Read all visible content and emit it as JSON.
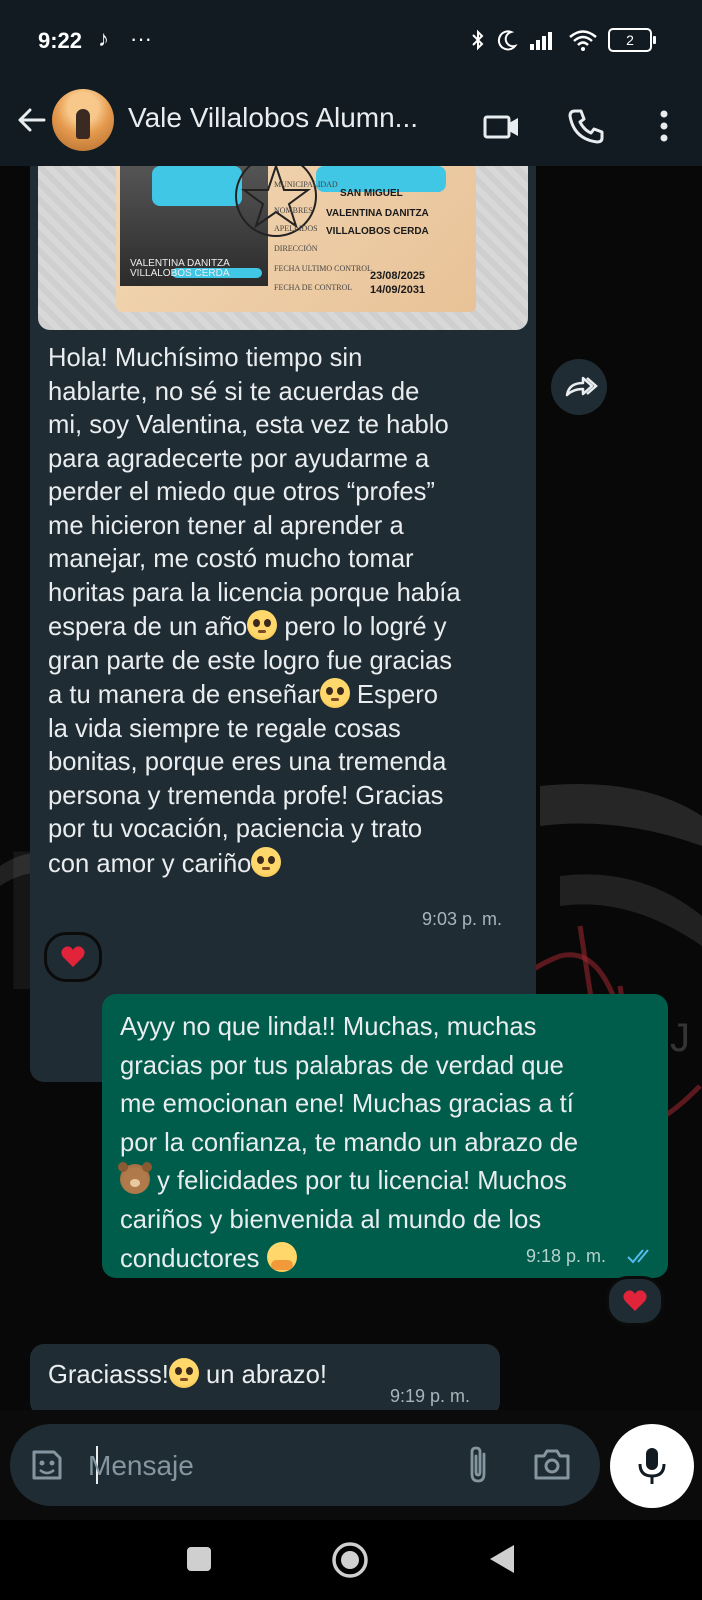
{
  "status_bar": {
    "time": "9:22",
    "battery": "2",
    "icons": [
      "tiktok-icon",
      "more-icon",
      "bluetooth-icon",
      "moon-icon",
      "signal-icon",
      "wifi-icon",
      "battery-icon"
    ]
  },
  "header": {
    "contact_name": "Vale Villalobos Alumn...",
    "icons": [
      "back-arrow-icon",
      "video-call-icon",
      "phone-call-icon",
      "overflow-menu-icon"
    ]
  },
  "id_card": {
    "lines": [
      "SAN MIGUEL",
      "VALENTINA DANITZA",
      "VILLALOBOS CERDA"
    ],
    "photo_caption": [
      "VALENTINA DANITZA",
      "VILLALOBOS CERDA"
    ],
    "date_1": "23/08/2025",
    "date_2": "14/09/2031",
    "field_labels": [
      "MUNICIPALIDAD",
      "NOMBRES",
      "APELLIDOS",
      "DIRECCIÓN",
      "FECHA ULTIMO CONTROL",
      "FECHA DE CONTROL"
    ]
  },
  "messages": [
    {
      "direction": "incoming",
      "parts": [
        "Hola! Muchísimo tiempo sin",
        "hablarte, no sé si te acuerdas de",
        "mi, soy Valentina, esta vez te hablo",
        "para agradecerte por ayudarme a",
        "perder el miedo que otros “profes”",
        "me hicieron tener al aprender a",
        "manejar, me costó mucho tomar",
        "horitas para la licencia porque había",
        "espera de un año",
        " pero lo logré y",
        "gran parte de este logro fue gracias",
        "a tu manera de enseñar",
        " Espero",
        "la vida siempre te regale cosas",
        "bonitas, porque eres una tremenda",
        "persona y tremenda profe! Gracias",
        "por tu vocación, paciencia y trato",
        "con amor y cariño"
      ],
      "time": "9:03 p. m.",
      "reaction": "❤"
    },
    {
      "direction": "outgoing",
      "lines": [
        "Ayyy no que linda!! Muchas, muchas",
        "gracias por tus palabras de verdad que",
        "me emocionan ene! Muchas gracias a tí",
        "por la confianza, te mando un abrazo de",
        " y felicidades por tu licencia! Muchos",
        "cariños y bienvenida al mundo de los",
        "conductores "
      ],
      "time": "9:18 p. m.",
      "status": "read",
      "reaction": "❤"
    },
    {
      "direction": "incoming",
      "text_before": "Graciasss!",
      "text_after": " un abrazo!",
      "time": "9:19 p. m."
    }
  ],
  "composer": {
    "placeholder": "Mensaje",
    "icons": [
      "sticker-icon",
      "attach-icon",
      "camera-icon",
      "mic-icon"
    ]
  },
  "nav": {
    "icons": [
      "recents-icon",
      "home-icon",
      "back-icon"
    ]
  },
  "colors": {
    "incoming_bubble": "#202c33",
    "outgoing_bubble": "#005c4b",
    "header_bg": "#111b21",
    "read_ticks": "#53bdeb"
  }
}
